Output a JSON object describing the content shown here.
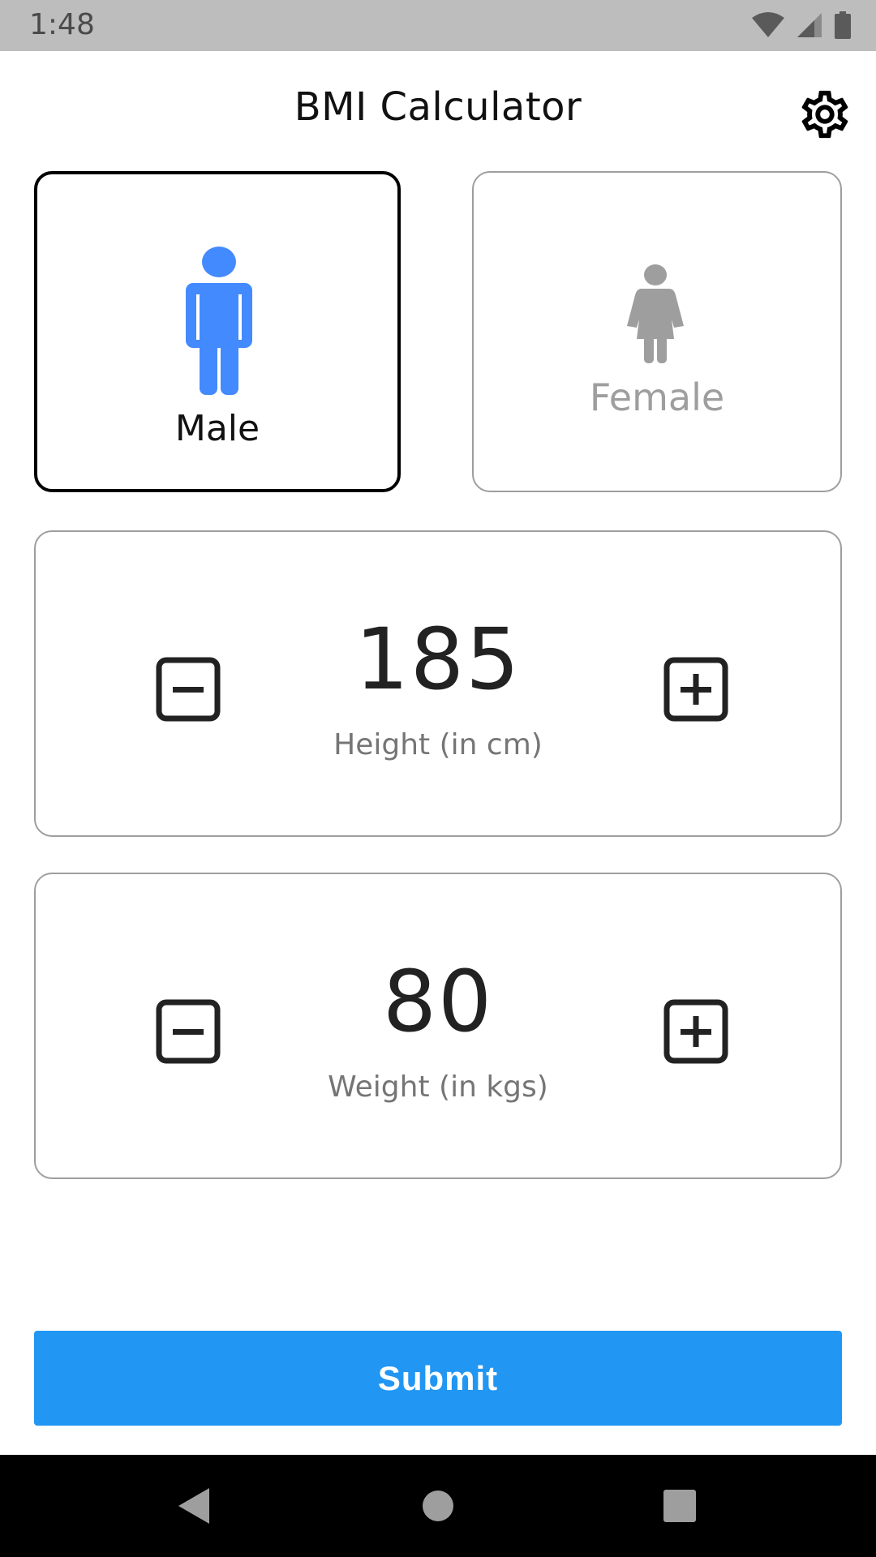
{
  "status_bar": {
    "time": "1:48",
    "icons": [
      "wifi-icon",
      "cellular-signal-icon",
      "battery-icon"
    ]
  },
  "header": {
    "title": "BMI Calculator",
    "settings_icon": "gear-icon"
  },
  "gender": {
    "options": [
      {
        "label": "Male",
        "icon": "male-icon",
        "selected": true,
        "color": "#448aff"
      },
      {
        "label": "Female",
        "icon": "female-icon",
        "selected": false,
        "color": "#9e9e9e"
      }
    ]
  },
  "height": {
    "value": "185",
    "label": "Height (in cm)",
    "decrement_icon": "minus-box-icon",
    "increment_icon": "plus-box-icon"
  },
  "weight": {
    "value": "80",
    "label": "Weight (in kgs)",
    "decrement_icon": "minus-box-icon",
    "increment_icon": "plus-box-icon"
  },
  "submit": {
    "label": "Submit",
    "color": "#2196f3"
  },
  "nav_bar": {
    "icons": [
      "back-triangle-icon",
      "home-circle-icon",
      "recents-square-icon"
    ]
  }
}
